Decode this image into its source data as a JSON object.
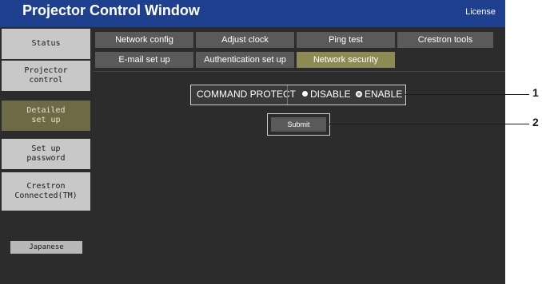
{
  "window": {
    "title": "Projector Control Window",
    "license_link": "License"
  },
  "sidebar": {
    "items": [
      {
        "label": "Status"
      },
      {
        "label": "Projector\ncontrol"
      },
      {
        "label": "Detailed\nset up"
      },
      {
        "label": "Set up\npassword"
      },
      {
        "label": "Crestron\nConnected(TM)"
      }
    ],
    "language_button": "Japanese"
  },
  "tabs": {
    "row1": [
      "Network config",
      "Adjust clock",
      "Ping test",
      "Crestron tools"
    ],
    "row2": [
      "E-mail set up",
      "Authentication set up",
      "Network security"
    ],
    "active": "Network security"
  },
  "command_protect": {
    "label": "COMMAND PROTECT",
    "options": [
      "DISABLE",
      "ENABLE"
    ],
    "selected": "ENABLE"
  },
  "submit_label": "Submit",
  "callouts": [
    "1",
    "2"
  ],
  "colors": {
    "title_bar": "#1f3f8f",
    "active_item": "#6e6a45",
    "active_tab": "#8f8a54"
  }
}
